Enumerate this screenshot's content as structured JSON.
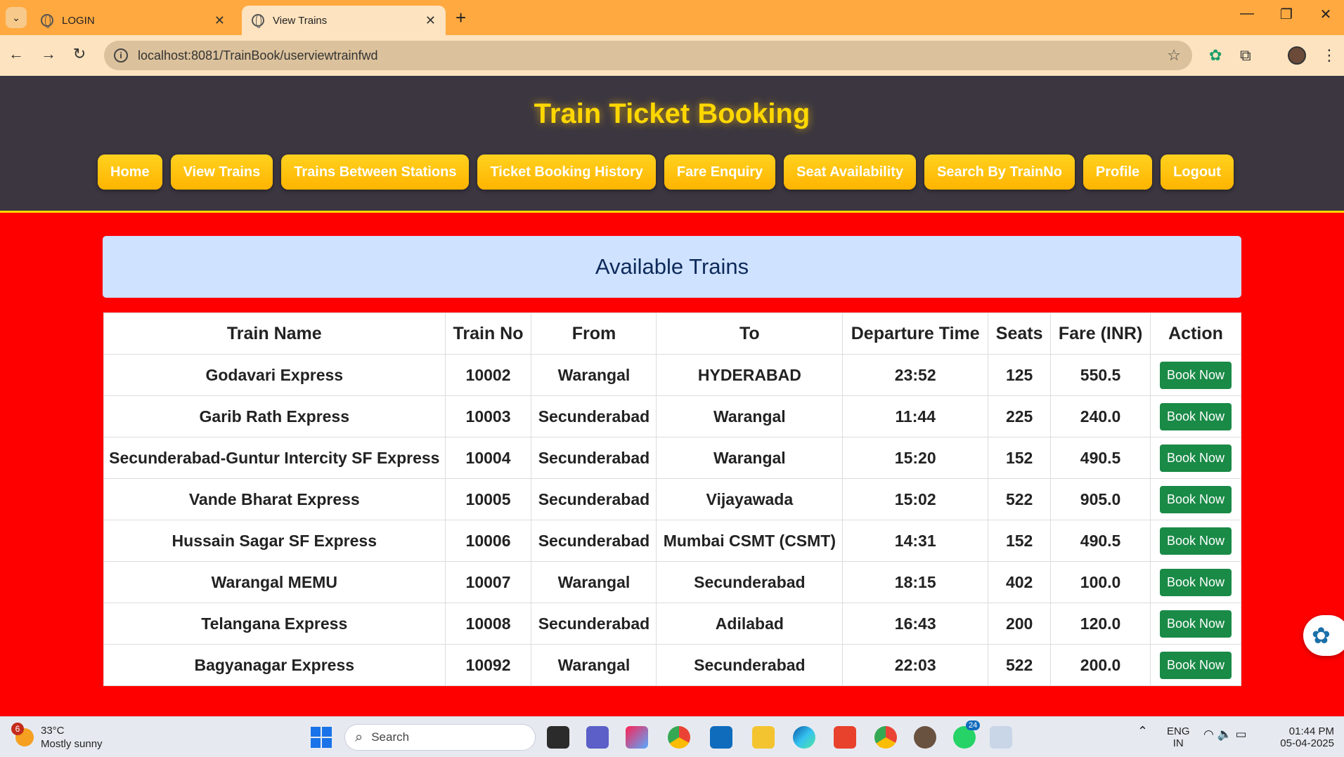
{
  "browser": {
    "tabs": [
      {
        "title": "LOGIN",
        "active": false
      },
      {
        "title": "View Trains",
        "active": true
      }
    ],
    "url": "localhost:8081/TrainBook/userviewtrainfwd"
  },
  "site": {
    "title": "Train Ticket Booking",
    "nav": [
      "Home",
      "View Trains",
      "Trains Between Stations",
      "Ticket Booking History",
      "Fare Enquiry",
      "Seat Availability",
      "Search By TrainNo",
      "Profile",
      "Logout"
    ]
  },
  "content": {
    "panel_title": "Available Trains",
    "columns": [
      "Train Name",
      "Train No",
      "From",
      "To",
      "Departure Time",
      "Seats",
      "Fare (INR)",
      "Action"
    ],
    "rows": [
      {
        "name": "Godavari Express",
        "no": "10002",
        "from": "Warangal",
        "to": "HYDERABAD",
        "time": "23:52",
        "seats": "125",
        "fare": "550.5",
        "action": "Book Now"
      },
      {
        "name": "Garib Rath Express",
        "no": "10003",
        "from": "Secunderabad",
        "to": "Warangal",
        "time": "11:44",
        "seats": "225",
        "fare": "240.0",
        "action": "Book Now"
      },
      {
        "name": "Secunderabad-Guntur Intercity SF Express",
        "no": "10004",
        "from": "Secunderabad",
        "to": "Warangal",
        "time": "15:20",
        "seats": "152",
        "fare": "490.5",
        "action": "Book Now"
      },
      {
        "name": "Vande Bharat Express",
        "no": "10005",
        "from": "Secunderabad",
        "to": "Vijayawada",
        "time": "15:02",
        "seats": "522",
        "fare": "905.0",
        "action": "Book Now"
      },
      {
        "name": "Hussain Sagar SF Express",
        "no": "10006",
        "from": "Secunderabad",
        "to": "Mumbai CSMT (CSMT)",
        "time": "14:31",
        "seats": "152",
        "fare": "490.5",
        "action": "Book Now"
      },
      {
        "name": "Warangal MEMU",
        "no": "10007",
        "from": "Warangal",
        "to": "Secunderabad",
        "time": "18:15",
        "seats": "402",
        "fare": "100.0",
        "action": "Book Now"
      },
      {
        "name": "Telangana Express",
        "no": "10008",
        "from": "Secunderabad",
        "to": "Adilabad",
        "time": "16:43",
        "seats": "200",
        "fare": "120.0",
        "action": "Book Now"
      },
      {
        "name": "Bagyanagar Express",
        "no": "10092",
        "from": "Warangal",
        "to": "Secunderabad",
        "time": "22:03",
        "seats": "522",
        "fare": "200.0",
        "action": "Book Now"
      }
    ]
  },
  "taskbar": {
    "weather_badge": "6",
    "weather_temp": "33°C",
    "weather_desc": "Mostly sunny",
    "search_placeholder": "Search",
    "teams_badge": "24",
    "lang_top": "ENG",
    "lang_bottom": "IN",
    "time": "01:44 PM",
    "date": "05-04-2025"
  },
  "colors": {
    "page_bg": "#ff0000",
    "header_bg": "#3b3640",
    "nav_button": "#ffc107",
    "title_gold": "#ffd700",
    "book_button": "#1a8a47",
    "seats_green": "#1e8a3e",
    "panel_bg": "#cfe2ff"
  }
}
